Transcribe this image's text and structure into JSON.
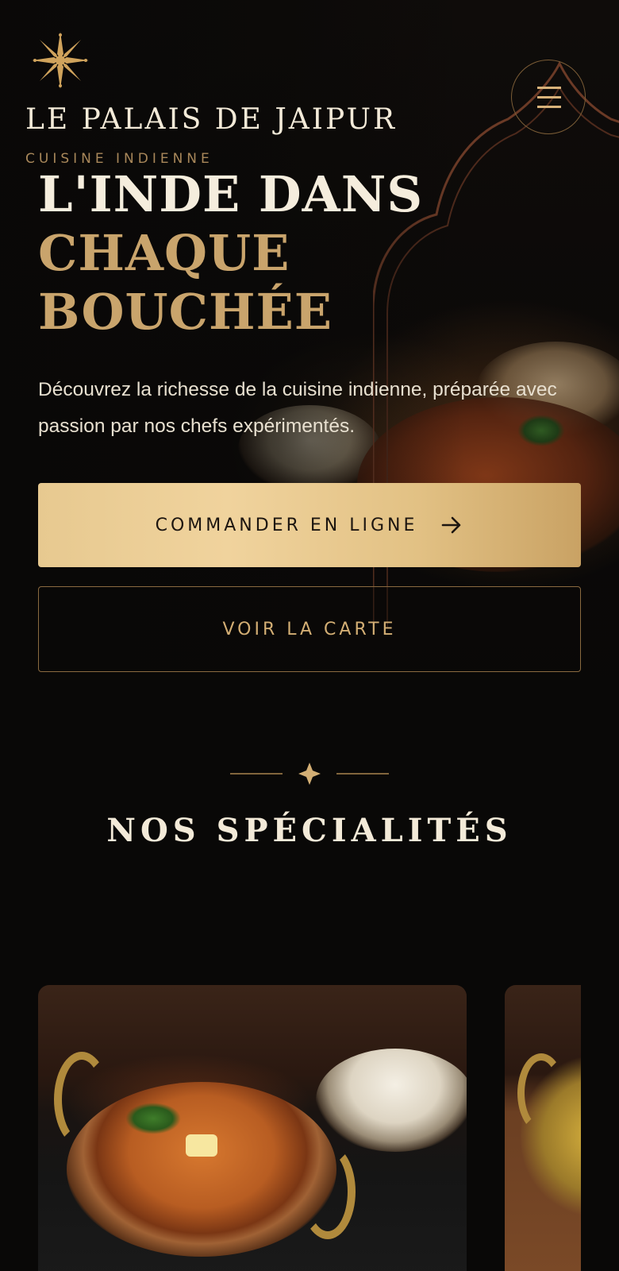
{
  "header": {
    "brand_name": "LE PALAIS DE JAIPUR",
    "brand_subtitle": "CUISINE INDIENNE",
    "logo_icon": "sun-mandala-icon",
    "menu_icon": "hamburger-menu-icon"
  },
  "hero": {
    "headline_line1": "L'INDE DANS",
    "headline_line2": "CHAQUE",
    "headline_line3": "BOUCHÉE",
    "intro_text": "Découvrez la richesse de la cuisine indienne, préparée avec passion par nos chefs expérimentés.",
    "primary_cta": "COMMANDER EN LIGNE",
    "primary_cta_icon": "arrow-right-icon",
    "secondary_cta": "VOIR LA CARTE"
  },
  "specialties": {
    "ornament_icon": "sparkle-divider-icon",
    "title": "NOS SPÉCIALITÉS"
  },
  "colors": {
    "background": "#090807",
    "gold": "#c9a46c",
    "gold_light": "#f0d39d",
    "text_light": "#f3ead8"
  }
}
